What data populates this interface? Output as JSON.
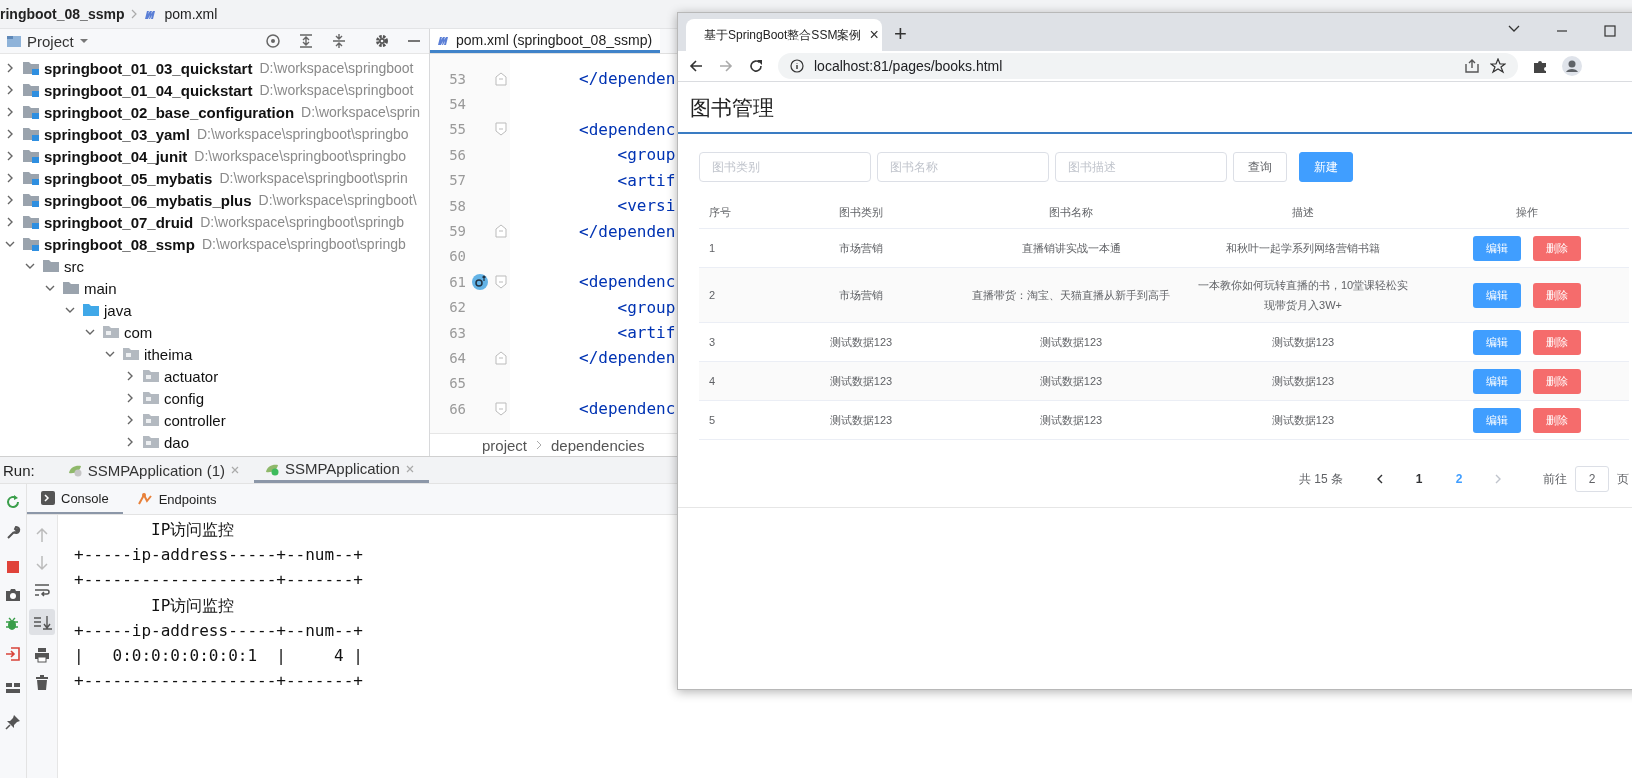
{
  "ide": {
    "breadcrumb": [
      "ringboot_08_ssmp",
      "pom.xml"
    ],
    "project_panel": {
      "title": "Project",
      "tree": [
        {
          "name": "springboot_01_03_quickstart",
          "path": "D:\\workspace\\springboot",
          "kind": "module",
          "expanded": false
        },
        {
          "name": "springboot_01_04_quickstart",
          "path": "D:\\workspace\\springboot",
          "kind": "module",
          "expanded": false
        },
        {
          "name": "springboot_02_base_configuration",
          "path": "D:\\workspace\\sprin",
          "kind": "module",
          "expanded": false
        },
        {
          "name": "springboot_03_yaml",
          "path": "D:\\workspace\\springboot\\springbo",
          "kind": "module",
          "expanded": false
        },
        {
          "name": "springboot_04_junit",
          "path": "D:\\workspace\\springboot\\springbo",
          "kind": "module",
          "expanded": false
        },
        {
          "name": "springboot_05_mybatis",
          "path": "D:\\workspace\\springboot\\sprin",
          "kind": "module",
          "expanded": false
        },
        {
          "name": "springboot_06_mybatis_plus",
          "path": "D:\\workspace\\springboot\\",
          "kind": "module",
          "expanded": false
        },
        {
          "name": "springboot_07_druid",
          "path": "D:\\workspace\\springboot\\springb",
          "kind": "module",
          "expanded": false
        },
        {
          "name": "springboot_08_ssmp",
          "path": "D:\\workspace\\springboot\\springb",
          "kind": "module",
          "expanded": true,
          "children": [
            {
              "name": "src",
              "kind": "folder",
              "expanded": true,
              "children": [
                {
                  "name": "main",
                  "kind": "folder",
                  "expanded": true,
                  "children": [
                    {
                      "name": "java",
                      "kind": "source",
                      "expanded": true,
                      "children": [
                        {
                          "name": "com",
                          "kind": "package",
                          "expanded": true,
                          "children": [
                            {
                              "name": "itheima",
                              "kind": "package",
                              "expanded": true,
                              "children": [
                                {
                                  "name": "actuator",
                                  "kind": "package",
                                  "expanded": false
                                },
                                {
                                  "name": "config",
                                  "kind": "package",
                                  "expanded": false
                                },
                                {
                                  "name": "controller",
                                  "kind": "package",
                                  "expanded": false
                                },
                                {
                                  "name": "dao",
                                  "kind": "package",
                                  "expanded": false
                                }
                              ]
                            }
                          ]
                        }
                      ]
                    }
                  ]
                }
              ]
            }
          ]
        }
      ]
    },
    "editor": {
      "tab": "pom.xml (springboot_08_ssmp)",
      "lines": [
        {
          "number": "53",
          "code": "</dependen",
          "fold_end": true
        },
        {
          "number": "54"
        },
        {
          "number": "55",
          "code": "<dependenc",
          "fold_start": true
        },
        {
          "number": "56",
          "code": "    <group"
        },
        {
          "number": "57",
          "code": "    <artif"
        },
        {
          "number": "58",
          "code": "    <versi"
        },
        {
          "number": "59",
          "code": "</dependen",
          "fold_end": true
        },
        {
          "number": "60"
        },
        {
          "number": "61",
          "code": "<dependenc",
          "fold_start": true,
          "gutter_icon": true
        },
        {
          "number": "62",
          "code": "    <group"
        },
        {
          "number": "63",
          "code": "    <artif"
        },
        {
          "number": "64",
          "code": "</dependen",
          "fold_end": true
        },
        {
          "number": "65"
        },
        {
          "number": "66",
          "code": "<dependenc",
          "fold_start": true
        }
      ],
      "breadcrumb": [
        "project",
        "dependencies"
      ]
    },
    "run_panel": {
      "label": "Run:",
      "tabs": [
        {
          "label": "SSMPApplication (1)",
          "selected": false
        },
        {
          "label": "SSMPApplication",
          "selected": true
        }
      ],
      "console_tabs": [
        {
          "label": "Console",
          "selected": true
        },
        {
          "label": "Endpoints",
          "selected": false
        }
      ],
      "output": [
        "        IP访问监控",
        "+-----ip-address-----+--num--+",
        "+--------------------+-------+",
        "        IP访问监控",
        "+-----ip-address-----+--num--+",
        "|   0:0:0:0:0:0:0:1  |     4 |",
        "+--------------------+-------+"
      ]
    }
  },
  "browser": {
    "tab": {
      "title": "基于SpringBoot整合SSM案例",
      "close": "×"
    },
    "new_tab": "+",
    "url": "localhost:81/pages/books.html",
    "page": {
      "title": "图书管理",
      "filters": [
        {
          "placeholder": "图书类别"
        },
        {
          "placeholder": "图书名称"
        },
        {
          "placeholder": "图书描述"
        }
      ],
      "buttons": [
        {
          "label": "查询",
          "kind": "default"
        },
        {
          "label": "新建",
          "kind": "primary"
        }
      ],
      "table": {
        "columns": [
          "序号",
          "图书类别",
          "图书名称",
          "描述",
          "操作"
        ],
        "rows": [
          {
            "cells": [
              "1",
              "市场营销",
              "直播销讲实战一本通",
              "和秋叶一起学系列网络营销书籍"
            ],
            "actions": [
              {
                "label": "编辑",
                "kind": "primary"
              },
              {
                "label": "删除",
                "kind": "danger"
              }
            ]
          },
          {
            "cells": [
              "2",
              "市场营销",
              "直播带货：淘宝、天猫直播从新手到高手",
              "一本教你如何玩转直播的书，10堂课轻松实现带货月入3W+"
            ],
            "actions": [
              {
                "label": "编辑",
                "kind": "primary"
              },
              {
                "label": "删除",
                "kind": "danger"
              }
            ]
          },
          {
            "cells": [
              "3",
              "测试数据123",
              "测试数据123",
              "测试数据123"
            ],
            "actions": [
              {
                "label": "编辑",
                "kind": "primary"
              },
              {
                "label": "删除",
                "kind": "danger"
              }
            ]
          },
          {
            "cells": [
              "4",
              "测试数据123",
              "测试数据123",
              "测试数据123"
            ],
            "actions": [
              {
                "label": "编辑",
                "kind": "primary"
              },
              {
                "label": "删除",
                "kind": "danger"
              }
            ]
          },
          {
            "cells": [
              "5",
              "测试数据123",
              "测试数据123",
              "测试数据123"
            ],
            "actions": [
              {
                "label": "编辑",
                "kind": "primary"
              },
              {
                "label": "删除",
                "kind": "danger"
              }
            ]
          }
        ]
      },
      "pagination": {
        "total": "共 15 条",
        "prev_disabled": false,
        "next_disabled": true,
        "pages": [
          {
            "label": "1",
            "selected": false
          },
          {
            "label": "2",
            "selected": true
          }
        ],
        "jump_label": "前往",
        "jump_value": "2",
        "page_unit": "页"
      }
    }
  }
}
